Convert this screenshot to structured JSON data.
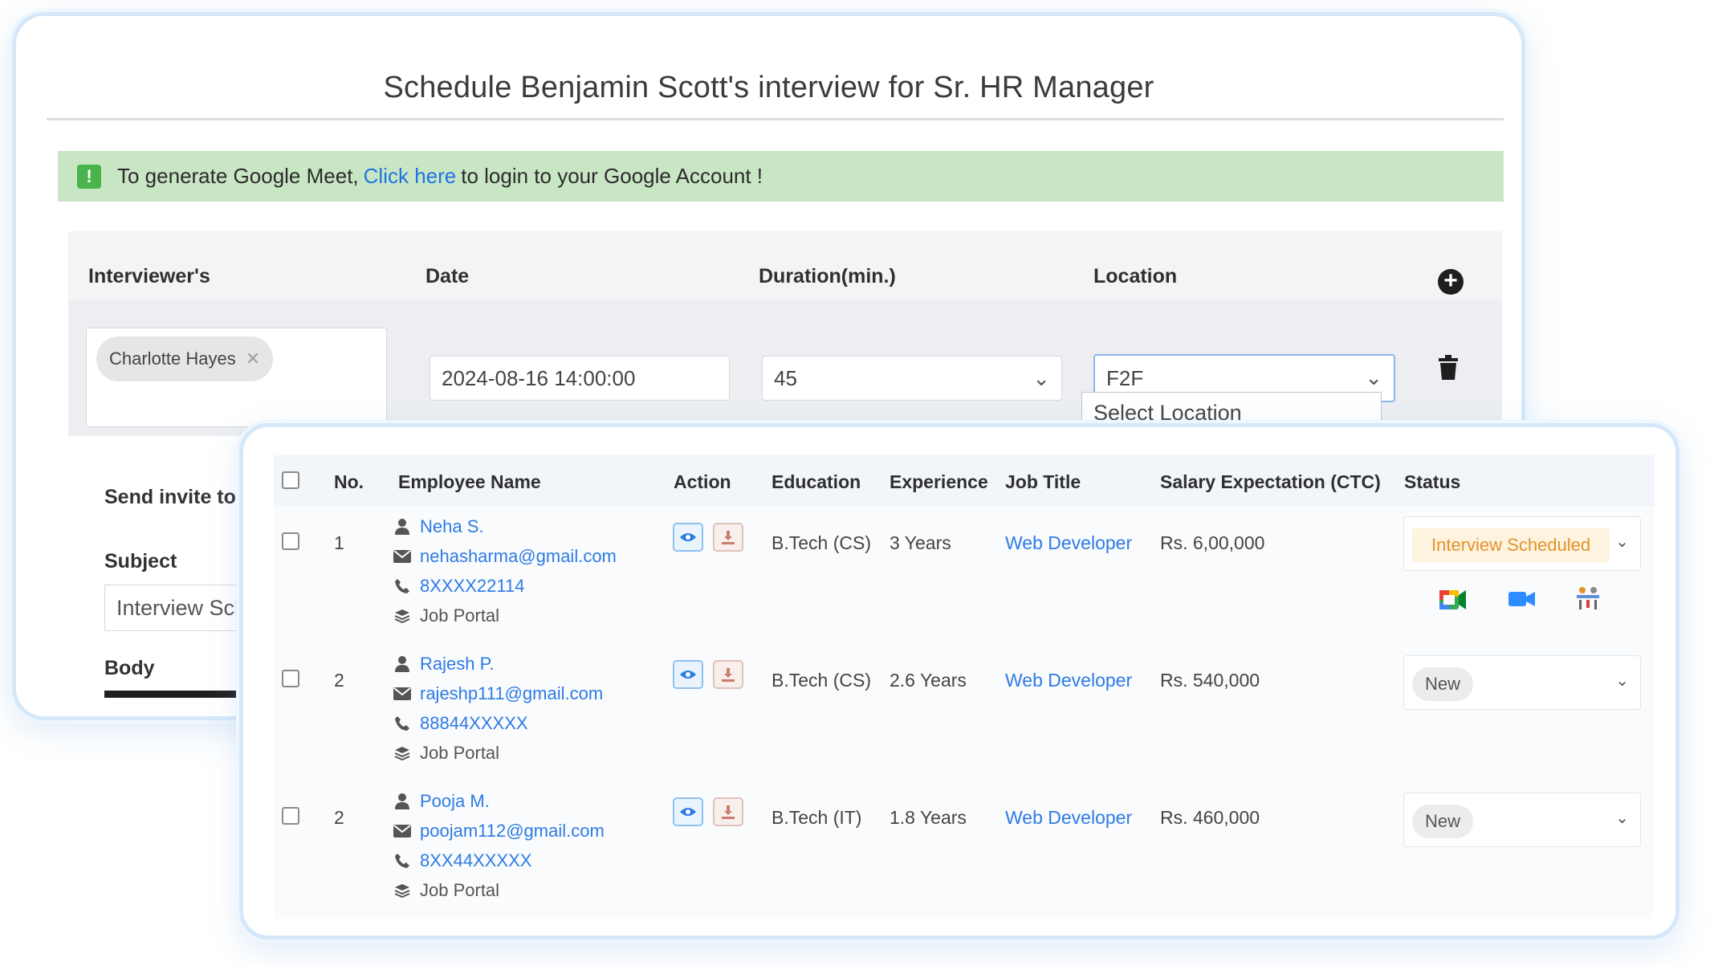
{
  "schedule": {
    "title": "Schedule Benjamin Scott's interview for Sr. HR Manager",
    "alert": {
      "prefix": "To generate Google Meet,",
      "link": "Click here",
      "suffix": "to login to your Google Account !"
    },
    "headers": {
      "interviewers": "Interviewer's",
      "date": "Date",
      "duration": "Duration(min.)",
      "location": "Location"
    },
    "interviewer_chip": "Charlotte Hayes",
    "date_value": "2024-08-16 14:00:00",
    "duration_value": "45",
    "location_value": "F2F",
    "location_option": "Select Location",
    "send_invite_label": "Send invite to can",
    "subject_label": "Subject",
    "subject_value": "Interview Sche",
    "body_label": "Body"
  },
  "table": {
    "columns": [
      "No.",
      "Employee Name",
      "Action",
      "Education",
      "Experience",
      "Job Title",
      "Salary Expectation (CTC)",
      "Status"
    ],
    "rows": [
      {
        "no": "1",
        "name": "Neha S.",
        "email": "nehasharma@gmail.com",
        "phone": "8XXXX22114",
        "source": "Job Portal",
        "education": "B.Tech (CS)",
        "experience": "3 Years",
        "job_title": "Web Developer",
        "salary": "Rs. 6,00,000",
        "status": "Interview Scheduled"
      },
      {
        "no": "2",
        "name": "Rajesh P.",
        "email": "rajeshp111@gmail.com",
        "phone": "88844XXXXX",
        "source": "Job Portal",
        "education": "B.Tech (CS)",
        "experience": "2.6 Years",
        "job_title": "Web Developer",
        "salary": "Rs. 540,000",
        "status": "New"
      },
      {
        "no": "2",
        "name": "Pooja M.",
        "email": "poojam112@gmail.com",
        "phone": "8XX44XXXXX",
        "source": "Job Portal",
        "education": "B.Tech (IT)",
        "experience": "1.8 Years",
        "job_title": "Web Developer",
        "salary": "Rs. 460,000",
        "status": "New"
      }
    ]
  },
  "colors": {
    "link": "#2d7be5",
    "alert_bg": "#c9e6c4",
    "status_scheduled": "#e5922a",
    "card_border": "#d5e8fa"
  },
  "icons": [
    "alert-icon",
    "plus-circle-icon",
    "trash-icon",
    "close-icon",
    "chevron-down-icon",
    "user-icon",
    "mail-icon",
    "phone-icon",
    "layers-icon",
    "eye-icon",
    "download-icon",
    "google-meet-icon",
    "zoom-video-icon",
    "in-person-meeting-icon"
  ]
}
